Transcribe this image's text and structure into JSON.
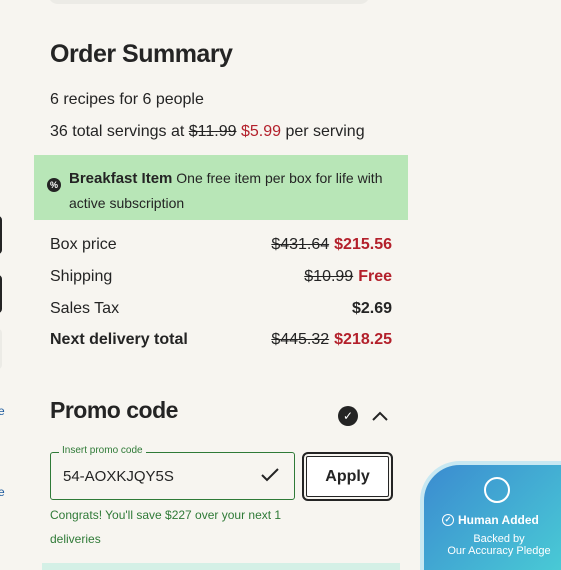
{
  "order_summary": {
    "title": "Order Summary",
    "recipes_line": "6 recipes for 6 people",
    "servings_prefix": "36 total servings at",
    "servings_old_price": "$11.99",
    "servings_new_price": "$5.99",
    "servings_suffix": "per serving"
  },
  "banner": {
    "title": "Breakfast Item",
    "text": "One free item per box for life with active subscription",
    "icon": "percent-icon"
  },
  "pricing": {
    "box_price": {
      "label": "Box price",
      "old": "$431.64",
      "new": "$215.56"
    },
    "shipping": {
      "label": "Shipping",
      "old": "$10.99",
      "new": "Free"
    },
    "sales_tax": {
      "label": "Sales Tax",
      "value": "$2.69"
    },
    "next_delivery": {
      "label": "Next delivery total",
      "old": "$445.32",
      "new": "$218.25"
    }
  },
  "promo": {
    "title": "Promo code",
    "input_label": "Insert promo code",
    "input_value": "54-AOXKJQY5S",
    "apply_label": "Apply",
    "message": "Congrats! You'll save $227 over your next 1 deliveries"
  },
  "badge": {
    "title": "Human Added",
    "line1": "Backed by",
    "line2": "Our Accuracy Pledge"
  },
  "edge_links": [
    "e",
    "e"
  ],
  "colors": {
    "sale_red": "#b3202b",
    "success_green": "#2f7a37",
    "banner_green": "#b8e6b7",
    "page_bg": "#f7f5f0"
  }
}
